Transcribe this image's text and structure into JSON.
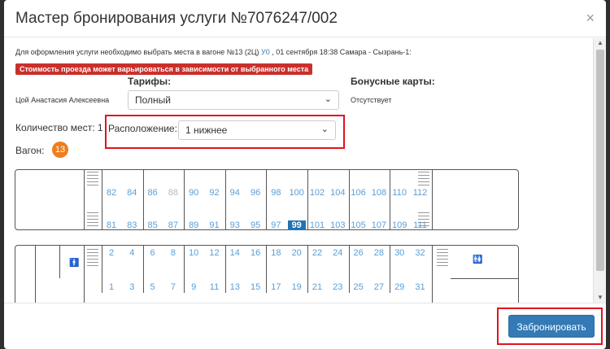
{
  "modal": {
    "title": "Мастер бронирования услуги №7076247/002",
    "close_symbol": "×"
  },
  "info": {
    "prefix": "Для оформления услуги необходимо выбрать места в вагоне №13 (2Ц) ",
    "link": "У0",
    "suffix": " , 01 сентября 18:38 Самара - Сызрань-1:"
  },
  "warning": "Стоимость проезда может варьироваться в зависимости от выбранного места",
  "tariffs": {
    "label": "Тарифы:",
    "value": "Полный"
  },
  "bonus": {
    "label": "Бонусные карты:",
    "value": "Отсутствует"
  },
  "passenger": "Цой Анастасия Алексеевна",
  "seat_count": "Количество мест: 1",
  "location": {
    "label": "Расположение:",
    "value": "1 нижнее"
  },
  "wagon": {
    "label": "Вагон:",
    "number": "13"
  },
  "wagon1": {
    "upper_seats": [
      "82",
      "84",
      "86",
      "88",
      "90",
      "92",
      "94",
      "96",
      "98",
      "100",
      "102",
      "104",
      "106",
      "108",
      "110",
      "112"
    ],
    "lower_seats": [
      "81",
      "83",
      "85",
      "87",
      "89",
      "91",
      "93",
      "95",
      "97",
      "99",
      "101",
      "103",
      "105",
      "107",
      "109",
      "111"
    ],
    "taken": [
      "88"
    ],
    "selected": "99"
  },
  "wagon2": {
    "upper_seats": [
      "2",
      "4",
      "6",
      "8",
      "10",
      "12",
      "14",
      "16",
      "18",
      "20",
      "22",
      "24",
      "26",
      "28",
      "30",
      "32"
    ],
    "lower_seats": [
      "1",
      "3",
      "5",
      "7",
      "9",
      "11",
      "13",
      "15",
      "17",
      "19",
      "21",
      "23",
      "25",
      "27",
      "29",
      "31"
    ]
  },
  "footer": {
    "book_label": "Забронировать"
  }
}
